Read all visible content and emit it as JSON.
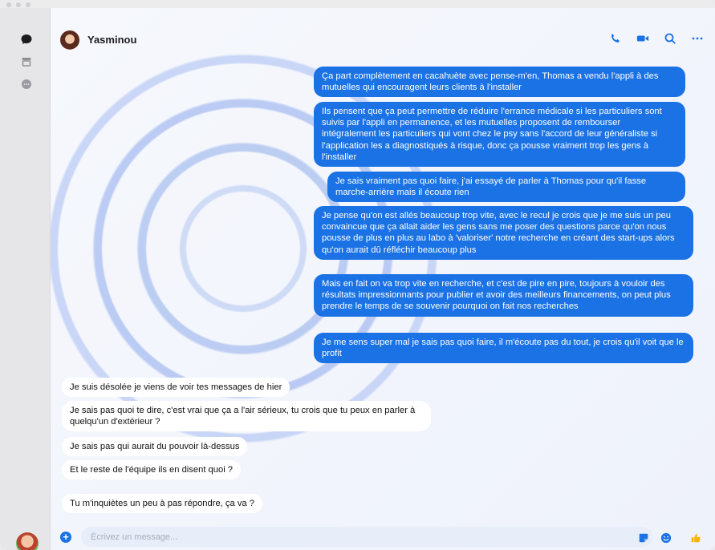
{
  "contact": {
    "name": "Yasminou"
  },
  "messages": [
    {
      "dir": "out",
      "text": "Ça part complètement en cacahuète avec pense-m'en, Thomas a vendu l'appli à des mutuelles qui encouragent leurs clients à l'installer"
    },
    {
      "dir": "out",
      "text": "Ils pensent que ça peut permettre de réduire l'errance médicale si les particuliers sont suivis par l'appli en permanence, et les mutuelles proposent de rembourser intégralement les particuliers qui vont chez le psy sans l'accord de leur généraliste si l'application les a diagnostiqués à risque, donc ça pousse vraiment trop les gens à l'installer"
    },
    {
      "dir": "out",
      "text": "Je sais vraiment pas quoi faire, j'ai essayé de parler à Thomas pour qu'il fasse marche-arrière mais il écoute rien"
    },
    {
      "dir": "out",
      "text": "Je pense qu'on est allés beaucoup trop vite, avec le recul je crois que je me suis un peu convaincue que ça allait aider les gens sans me poser des questions parce qu'on nous pousse de plus en plus au labo à 'valoriser' notre recherche en créant des start-ups alors qu'on aurait dû réfléchir beaucoup plus"
    },
    {
      "dir": "out",
      "text": "Mais en fait on va trop vite en recherche, et c'est de pire en pire, toujours à vouloir des résultats impressionnants pour publier et avoir des meilleurs financements, on peut plus prendre le temps de se souvenir pourquoi on fait nos recherches"
    },
    {
      "dir": "out",
      "text": "Je me sens super mal je sais pas quoi faire, il m'écoute pas du tout, je crois qu'il voit que le profit"
    },
    {
      "dir": "in",
      "text": "Je suis désolée je viens de voir tes messages de hier"
    },
    {
      "dir": "in",
      "text": "Je sais pas quoi te dire, c'est vrai que ça a l'air sérieux, tu crois que tu peux en parler à quelqu'un d'extérieur ?"
    },
    {
      "dir": "in",
      "text": "Je sais pas qui aurait du pouvoir là-dessus"
    },
    {
      "dir": "in",
      "text": "Et le reste de l'équipe ils en disent quoi ?"
    },
    {
      "dir": "in",
      "text": "Tu m'inquiètes un peu à pas répondre, ça va ?"
    }
  ],
  "composer": {
    "placeholder": "Écrivez un message..."
  },
  "colors": {
    "accent": "#1a72e4",
    "incoming_bg": "#ffffff",
    "sidebar": "#e6e6e9"
  },
  "icons": {
    "sidebar": [
      "chat-icon",
      "store-icon",
      "bubble-icon"
    ],
    "header": [
      "phone-icon",
      "video-icon",
      "search-icon",
      "more-icon"
    ],
    "composer": [
      "plus-icon",
      "sticker-icon",
      "emoji-icon",
      "thumbs-up-icon"
    ]
  }
}
